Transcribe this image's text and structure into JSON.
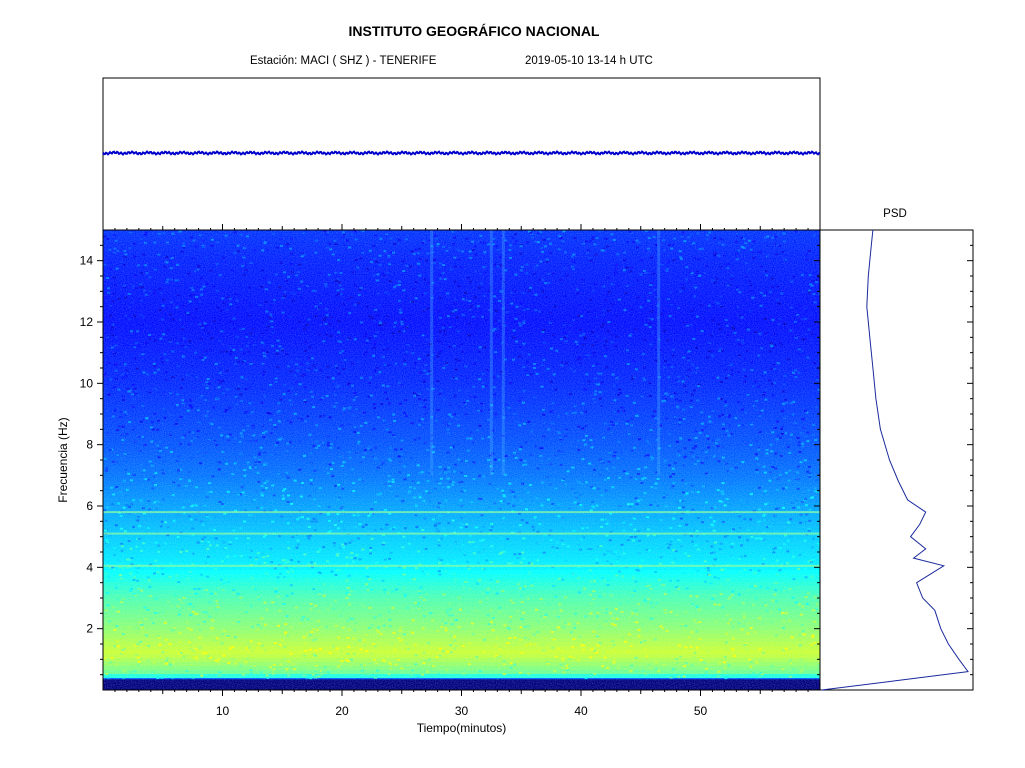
{
  "header": {
    "title": "INSTITUTO GEOGRÁFICO NACIONAL",
    "station": "Estación:  MACI ( SHZ ) - TENERIFE",
    "date": "2019-05-10  13-14 h UTC"
  },
  "psd_title": "PSD",
  "chart_data": [
    {
      "type": "line",
      "title": "",
      "description_hidden": true,
      "series": [
        {
          "values": "flat seismogram trace near mid-top of panel"
        }
      ]
    },
    {
      "type": "heatmap",
      "xlabel": "Tiempo(minutos)",
      "ylabel": "Frecuencia  (Hz)",
      "xlim": [
        0,
        60
      ],
      "ylim": [
        0,
        15
      ],
      "xticks": [
        10,
        20,
        30,
        40,
        50
      ],
      "yticks": [
        2,
        4,
        6,
        8,
        10,
        12,
        14
      ],
      "colormap": [
        "#00007f",
        "#0000ff",
        "#0080ff",
        "#00ffff",
        "#80ff80",
        "#ffff00"
      ],
      "intensity_profile_hz": [
        {
          "f": 0.2,
          "level": 0.05
        },
        {
          "f": 0.5,
          "level": 0.75
        },
        {
          "f": 1.2,
          "level": 0.92
        },
        {
          "f": 2.0,
          "level": 0.82
        },
        {
          "f": 3.0,
          "level": 0.72
        },
        {
          "f": 4.0,
          "level": 0.58
        },
        {
          "f": 5.0,
          "level": 0.52
        },
        {
          "f": 6.0,
          "level": 0.45
        },
        {
          "f": 7.0,
          "level": 0.38
        },
        {
          "f": 8.0,
          "level": 0.33
        },
        {
          "f": 10.0,
          "level": 0.26
        },
        {
          "f": 12.0,
          "level": 0.22
        },
        {
          "f": 14.0,
          "level": 0.25
        },
        {
          "f": 15.0,
          "level": 0.28
        }
      ],
      "spectral_lines_hz": [
        4.05,
        5.1,
        5.8
      ],
      "vertical_bands_min": [
        27.5,
        32.5,
        33.5,
        46.5
      ]
    },
    {
      "type": "line",
      "title": "PSD",
      "ylim": [
        0,
        15
      ],
      "series": [
        {
          "points": [
            {
              "f": 0.0,
              "p": 0.01
            },
            {
              "f": 0.3,
              "p": 0.5
            },
            {
              "f": 0.6,
              "p": 0.98
            },
            {
              "f": 1.0,
              "p": 0.92
            },
            {
              "f": 1.5,
              "p": 0.85
            },
            {
              "f": 2.0,
              "p": 0.8
            },
            {
              "f": 2.6,
              "p": 0.76
            },
            {
              "f": 3.0,
              "p": 0.68
            },
            {
              "f": 3.5,
              "p": 0.64
            },
            {
              "f": 4.05,
              "p": 0.82
            },
            {
              "f": 4.3,
              "p": 0.62
            },
            {
              "f": 4.6,
              "p": 0.7
            },
            {
              "f": 5.0,
              "p": 0.6
            },
            {
              "f": 5.4,
              "p": 0.66
            },
            {
              "f": 5.8,
              "p": 0.7
            },
            {
              "f": 6.2,
              "p": 0.58
            },
            {
              "f": 6.8,
              "p": 0.52
            },
            {
              "f": 7.5,
              "p": 0.46
            },
            {
              "f": 8.5,
              "p": 0.4
            },
            {
              "f": 9.5,
              "p": 0.37
            },
            {
              "f": 10.5,
              "p": 0.35
            },
            {
              "f": 11.5,
              "p": 0.33
            },
            {
              "f": 12.5,
              "p": 0.31
            },
            {
              "f": 13.5,
              "p": 0.32
            },
            {
              "f": 14.5,
              "p": 0.34
            },
            {
              "f": 15.0,
              "p": 0.35
            }
          ]
        }
      ]
    }
  ]
}
